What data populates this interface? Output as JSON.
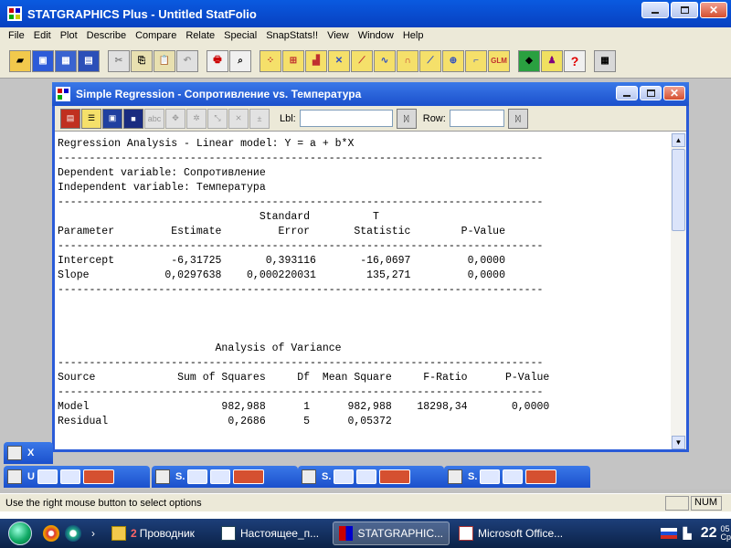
{
  "app": {
    "title": "STATGRAPHICS Plus - Untitled StatFolio",
    "minimize_glyph": "",
    "close_glyph": "✕"
  },
  "menu": [
    "File",
    "Edit",
    "Plot",
    "Describe",
    "Compare",
    "Relate",
    "Special",
    "SnapStats!!",
    "View",
    "Window",
    "Help"
  ],
  "child": {
    "title": "Simple Regression - Сопротивление vs. Температура",
    "lbl_label": "Lbl:",
    "row_label": "Row:",
    "lbl_value": "",
    "row_value": ""
  },
  "report_lines": [
    "Regression Analysis - Linear model: Y = a + b*X",
    "-----------------------------------------------------------------------------",
    "Dependent variable: Сопротивление",
    "Independent variable: Температура",
    "-----------------------------------------------------------------------------",
    "                                Standard          T",
    "Parameter         Estimate         Error       Statistic        P-Value",
    "-----------------------------------------------------------------------------",
    "Intercept         -6,31725       0,393116       -16,0697         0,0000",
    "Slope            0,0297638    0,000220031        135,271         0,0000",
    "-----------------------------------------------------------------------------",
    "",
    "",
    "",
    "                         Analysis of Variance",
    "-----------------------------------------------------------------------------",
    "Source             Sum of Squares     Df  Mean Square     F-Ratio      P-Value",
    "-----------------------------------------------------------------------------",
    "Model                     982,988      1      982,988    18298,34       0,0000",
    "Residual                   0,2686      5      0,05372"
  ],
  "minimized": [
    {
      "label": "U"
    },
    {
      "label": "S."
    },
    {
      "label": "S."
    },
    {
      "label": "S."
    },
    {
      "label": "X"
    }
  ],
  "status": {
    "hint": "Use the right mouse button to select options",
    "num": "NUM"
  },
  "taskbar": {
    "tasks": [
      {
        "label": "Проводник",
        "badge": "2"
      },
      {
        "label": "Настоящее_п..."
      },
      {
        "label": "STATGRAPHIC..."
      },
      {
        "label": "Microsoft Office..."
      }
    ],
    "clock_hour": "22",
    "clock_min": "05",
    "clock_sub": "Cp"
  },
  "colors": {
    "title_blue": "#0a5ae0",
    "child_blue": "#2a5bd8",
    "close_red": "#d55030"
  }
}
